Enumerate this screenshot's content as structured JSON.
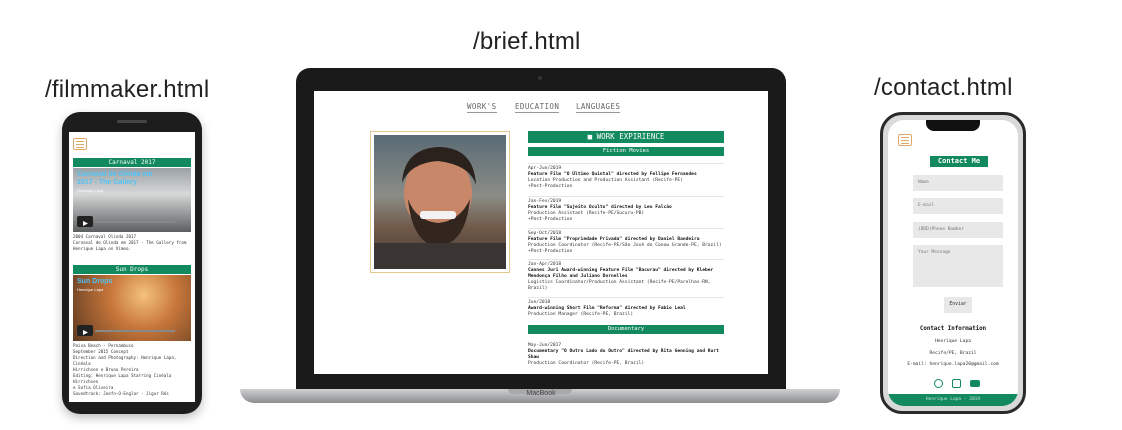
{
  "captions": {
    "left": "/filmmaker.html",
    "center": "/brief.html",
    "right": "/contact.html"
  },
  "filmmaker": {
    "section1": {
      "title": "Carnaval 2017",
      "video_title": "Carnaval de Olinda em 2017 - The Gallery",
      "video_sub": "Henrique Lapa",
      "desc": [
        "2004 Carnaval Olinda 2017",
        "Carnaval de Olinda em 2017 - The Gallery from",
        "Henrique Lapa on Vimeo."
      ]
    },
    "section2": {
      "title": "Sun Drops",
      "video_title": "Sun Drops",
      "video_sub": "Henrique Lapa",
      "desc": [
        "Paiva Beach - Pernambuco",
        "September 2015 Concept",
        "Direction and Photography: Henrique Lapa, Cinéala",
        "Hirrichsen e Bruno Pereira",
        "Editing: Henrique Lapa Starring Cinéala Hirrichsen",
        "e Sofia Oliveira",
        "Soundtrack: Joefn-O-Englar - Jigur Rós"
      ]
    }
  },
  "brief": {
    "nav": [
      "WORK'S",
      "EDUCATION",
      "LANGUAGES"
    ],
    "work_header": "WORK EXPIRIENCE",
    "fiction_header": "Fiction Movies",
    "jobs": [
      {
        "date": "Apr-Jun/2019",
        "title": "Feature Film \"O Último Quintal\" directed by Fellipe Fernandes",
        "lines": [
          "Location Production and Production Assistant (Recife-PE)",
          "+Post-Production"
        ]
      },
      {
        "date": "Jan-Fev/2019",
        "title": "Feature Film \"Sujeito Oculto\" directed by Leo Falcão",
        "lines": [
          "Production Assistant (Recife-PE/Sucuru-PB)",
          "+Post-Production"
        ]
      },
      {
        "date": "Sep-Oct/2018",
        "title": "Feature Film \"Propriedade Privada\" directed by Daniel Bandeira",
        "lines": [
          "Production Coordinator (Recife-PE/São José do Conow Grande-PE, Brazil)",
          "+Post-Production"
        ]
      },
      {
        "date": "Jan-Apr/2018",
        "title": "Cannes Juri Award-winning Feature Film \"Bacurau\" directed by Kleber Mendonça Filho and Juliano Dornelles",
        "lines": [
          "Logistics Coordinator/Production Assistant (Recife-PE/Parelhas-RN,",
          "Brazil)"
        ]
      },
      {
        "date": "Jun/2018",
        "title": "Award-winning Short Film \"Reforma\" directed by Fabio Leal",
        "lines": [
          "Production Manager (Recife-PE, Brazil)"
        ]
      }
    ],
    "doc_header": "Documentary",
    "doc_jobs": [
      {
        "date": "May-Jun/2017",
        "title": "Documentary \"O Outro Lado do Outro\" directed by Rita Genning and Kurt Shaw",
        "lines": [
          "Production Coordinator (Recife-PE, Brazil)"
        ]
      }
    ],
    "device_brand": "MacBook"
  },
  "contact": {
    "title": "Contact Me",
    "placeholders": [
      "Name",
      "E-mail",
      "(DDD)Phone Number",
      "Your Message"
    ],
    "send": "Enviar",
    "info_title": "Contact Information",
    "info": [
      "Henrique Lapa",
      "Recife/PE, Brazil",
      "E-mail: henrique.lapa20@gmail.com"
    ],
    "footer": "Henrique Lapa - 2019"
  },
  "colors": {
    "accent": "#138a5e",
    "frame_gold": "#e5c98f"
  },
  "icons": [
    "menu-icon",
    "video-camera-icon",
    "whatsapp-icon",
    "instagram-icon",
    "youtube-icon",
    "play-icon"
  ]
}
